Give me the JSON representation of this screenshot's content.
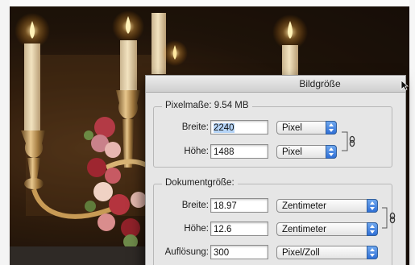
{
  "window": {
    "title": "Bildgröße"
  },
  "pixel_dimensions": {
    "heading": "Pixelmaße: 9.54 MB",
    "width_label": "Breite:",
    "width_value": "2240",
    "width_unit": "Pixel",
    "height_label": "Höhe:",
    "height_value": "1488",
    "height_unit": "Pixel"
  },
  "document_size": {
    "heading": "Dokumentgröße:",
    "width_label": "Breite:",
    "width_value": "18.97",
    "width_unit": "Zentimeter",
    "height_label": "Höhe:",
    "height_value": "12.6",
    "height_unit": "Zentimeter",
    "resolution_label": "Auflösung:",
    "resolution_value": "300",
    "resolution_unit": "Pixel/Zoll"
  },
  "icons": {
    "link": "chain-link-icon",
    "popup_arrows": "up-down-arrows-icon",
    "cursor": "mouse-pointer-icon"
  },
  "colors": {
    "dialog_bg": "#e6e6e6",
    "popup_arrow": "#3b7be0",
    "selection": "#b5d4f7"
  }
}
